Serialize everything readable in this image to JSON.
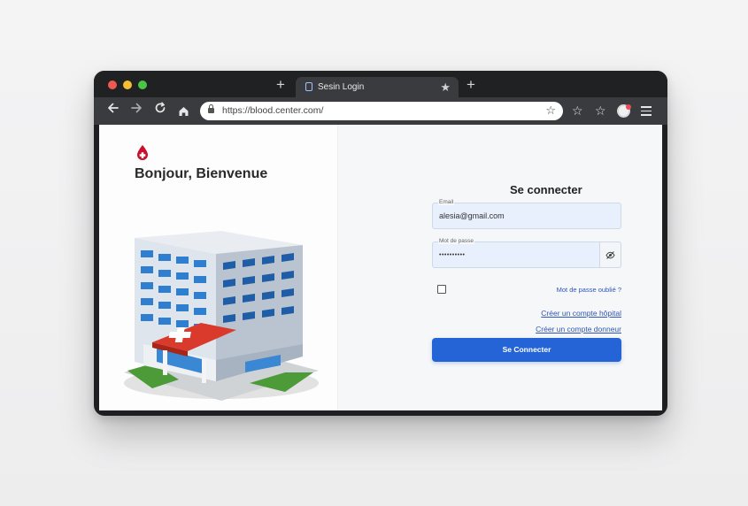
{
  "browser": {
    "tab_title": "Sesin Login",
    "url": "https://blood.center.com/",
    "new_tab_symbol": "+",
    "icons": [
      "back-arrow-icon",
      "forward-arrow-icon",
      "reload-icon",
      "home-icon",
      "lock-icon",
      "star-icon",
      "profile-icon",
      "menu-icon"
    ]
  },
  "left": {
    "welcome": "Bonjour, Bienvenue",
    "logo_icon": "blood-drop-icon",
    "illustration": "hospital-building"
  },
  "form": {
    "title": "Se connecter",
    "email_label": "Email",
    "email_value": "alesia@gmail.com",
    "password_label": "Mot de passe",
    "password_value": "••••••••••",
    "forgot_password": "Mot de passe oublié ?",
    "create_hospital": "Créer un compte hôpital",
    "create_donor": "Créer un compte donneur",
    "submit_label": "Se Connecter"
  },
  "colors": {
    "accent": "#2564d6",
    "link": "#2f55b8",
    "input_bg": "#e8f0fe",
    "blood_red": "#c8102e"
  }
}
